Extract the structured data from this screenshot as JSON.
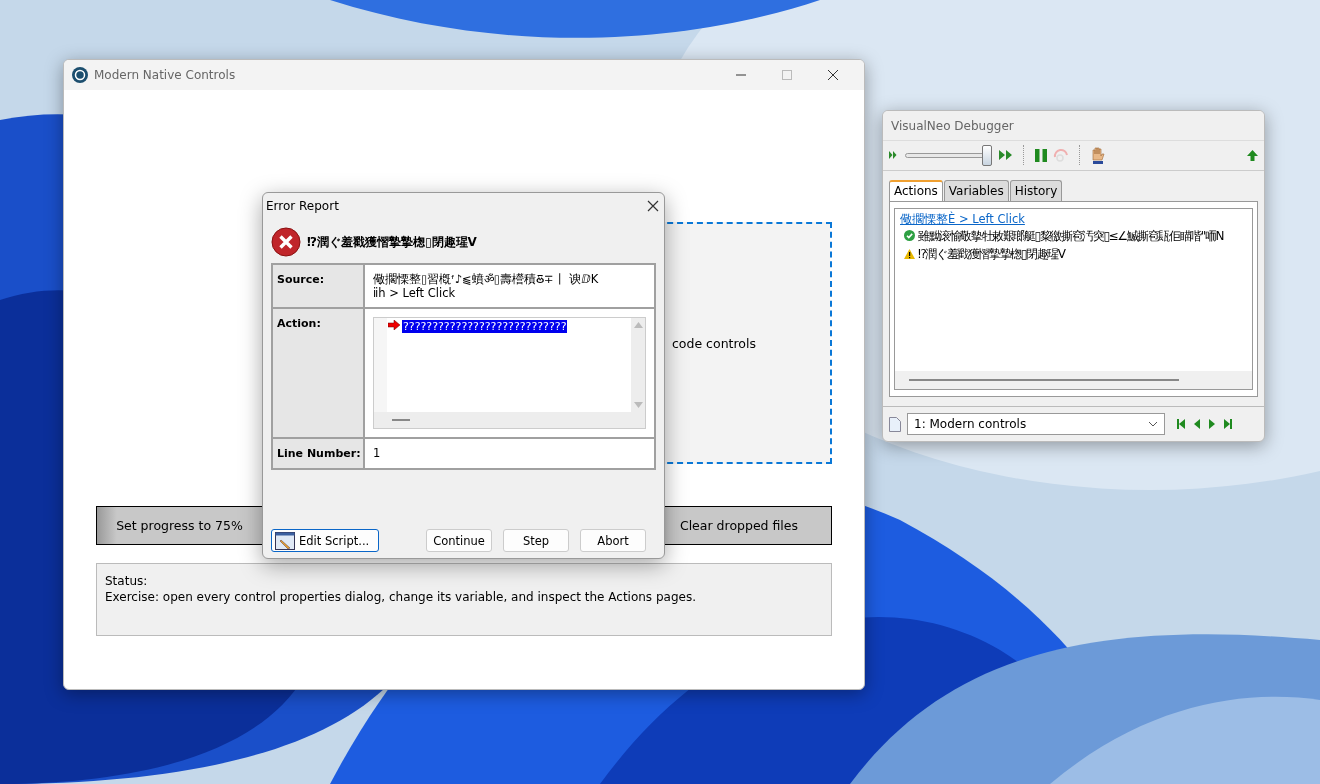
{
  "main_window": {
    "title": "Modern Native Controls",
    "drop_zone_label": "code controls",
    "buttons": [
      "Set progress to 75%",
      "Clear dropped files"
    ],
    "status": {
      "label": "Status:",
      "message": "Exercise: open every control properties dialog, change its variable, and inspect the Actions pages."
    }
  },
  "error_dialog": {
    "title": "Error Report",
    "message": "⁉潤ぐ羞戳獲慴摯摯楤▯閉趣瑆V",
    "fields": [
      {
        "label": "Source:",
        "kind": "text",
        "lines": [
          "儆擱慄整▯習槪ᶠ♪⫹蟦ॐ▯壽櫿積Ⰻ∓丨 谀ⅅK",
          "ⅱh > Left Click"
        ]
      },
      {
        "label": "Action:",
        "kind": "code",
        "value": "????????????????????????????"
      },
      {
        "label": "Line Number:",
        "kind": "text",
        "lines": [
          "1"
        ]
      }
    ],
    "buttons": [
      {
        "label": "Edit Script...",
        "kind": "icon"
      },
      {
        "label": "Continue",
        "kind": "plain"
      },
      {
        "label": "Step",
        "kind": "plain"
      },
      {
        "label": "Abort",
        "kind": "plain"
      }
    ]
  },
  "debugger": {
    "title": "VisualNeo Debugger",
    "speed": {
      "level": 0.93
    },
    "tabs": [
      {
        "label": "Actions",
        "selected": true
      },
      {
        "label": "Variables",
        "selected": false
      },
      {
        "label": "History",
        "selected": false
      }
    ],
    "actions": [
      {
        "kind": "link",
        "text": "儆擱慄整È > Left Click"
      },
      {
        "kind": "success",
        "text": "雖黝滚愉敬摰牡敕艱瑯艇▯䊍徼撕窇汚突▯≤∠鰄撕窇瓺佢瞄喈\"㖇N"
      },
      {
        "kind": "warning",
        "text": "⁉潤ぐ羞戳獲慴摯摯楤▯閉趣瑆V"
      }
    ],
    "page_select": {
      "value": "1: Modern controls"
    }
  }
}
